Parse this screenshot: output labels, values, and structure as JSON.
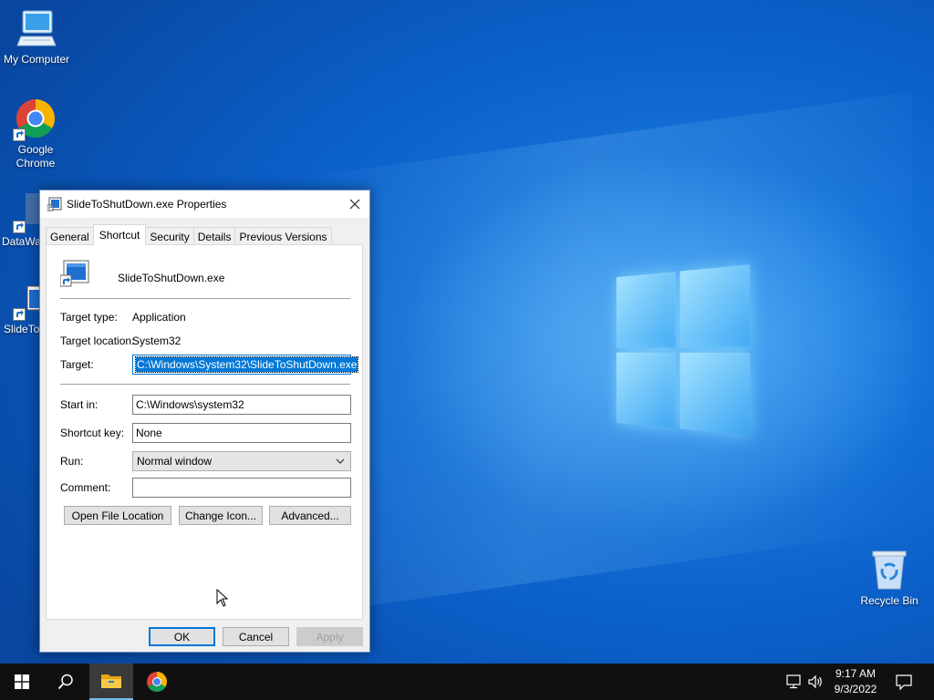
{
  "desktop": {
    "icons": [
      {
        "label": "My Computer"
      },
      {
        "label": "Google Chrome"
      },
      {
        "label": "DataWa"
      },
      {
        "label": "SlideTo"
      },
      {
        "label": "Recycle Bin"
      }
    ]
  },
  "dialog": {
    "title": "SlideToShutDown.exe Properties",
    "close_icon": "close-icon",
    "tabs": [
      {
        "label": "General"
      },
      {
        "label": "Shortcut",
        "active": true
      },
      {
        "label": "Security"
      },
      {
        "label": "Details"
      },
      {
        "label": "Previous Versions"
      }
    ],
    "shortcut": {
      "file_name": "SlideToShutDown.exe",
      "target_type_label": "Target type:",
      "target_type_value": "Application",
      "target_location_label": "Target location:",
      "target_location_value": "System32",
      "target_label": "Target:",
      "target_value": "C:\\Windows\\System32\\SlideToShutDown.exe",
      "start_in_label": "Start in:",
      "start_in_value": "C:\\Windows\\system32",
      "shortcut_key_label": "Shortcut key:",
      "shortcut_key_value": "None",
      "run_label": "Run:",
      "run_value": "Normal window",
      "comment_label": "Comment:",
      "comment_value": "",
      "open_file_location": "Open File Location",
      "change_icon": "Change Icon...",
      "advanced": "Advanced..."
    },
    "footer": {
      "ok": "OK",
      "cancel": "Cancel",
      "apply": "Apply"
    }
  },
  "taskbar": {
    "time": "9:17 AM",
    "date": "9/3/2022",
    "items": [
      "start-icon",
      "search-icon",
      "file-explorer-icon",
      "chrome-icon"
    ],
    "tray": [
      "network-icon",
      "volume-icon",
      "notifications-icon"
    ]
  }
}
